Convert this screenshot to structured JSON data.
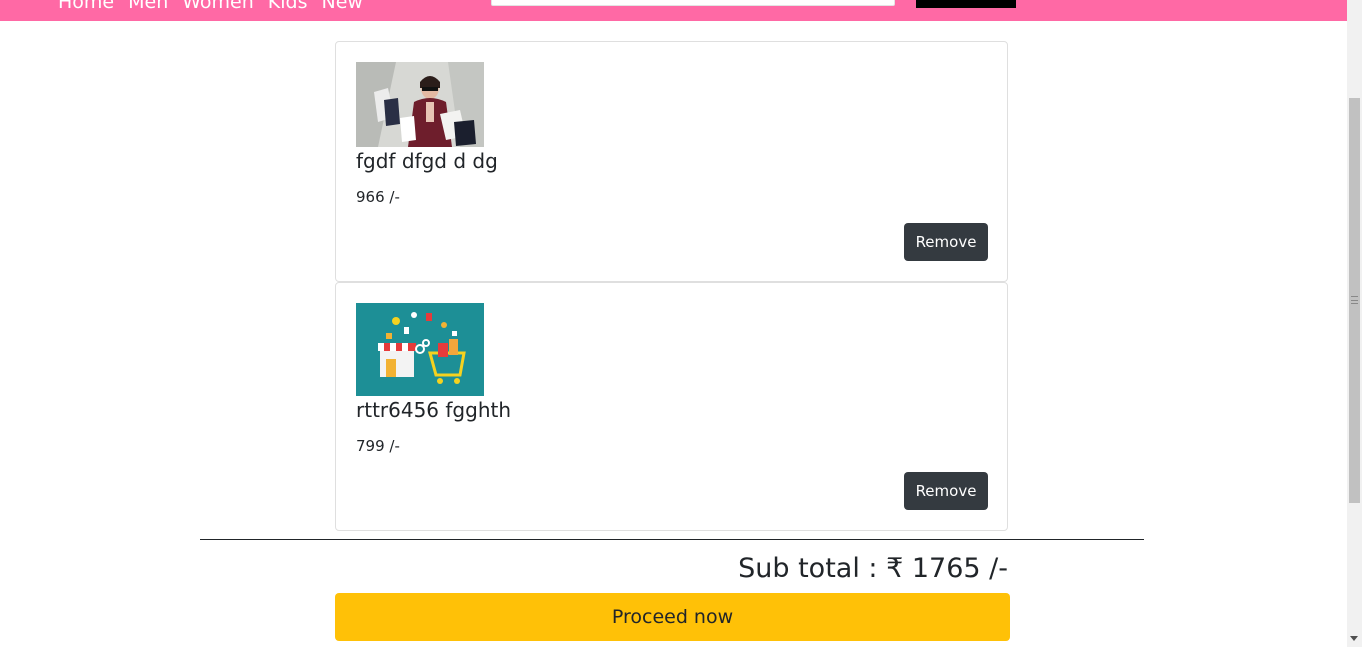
{
  "navbar": {
    "links": [
      "Home",
      "Men",
      "Women",
      "Kids",
      "New"
    ],
    "brand_color": "#ff69a5"
  },
  "cart": {
    "items": [
      {
        "name": "fgdf dfgd d dg",
        "price": "966 /-",
        "remove_label": "Remove",
        "image": "woman-shopping-bags-photo"
      },
      {
        "name": "rttr6456 fgghth",
        "price": "799 /-",
        "remove_label": "Remove",
        "image": "online-store-cart-illustration"
      }
    ],
    "subtotal_label": "Sub total : ₹ 1765 /-",
    "proceed_label": "Proceed now"
  },
  "colors": {
    "remove_button": "#343a40",
    "proceed_button": "#ffc107",
    "card_border": "#dfdfdf"
  }
}
